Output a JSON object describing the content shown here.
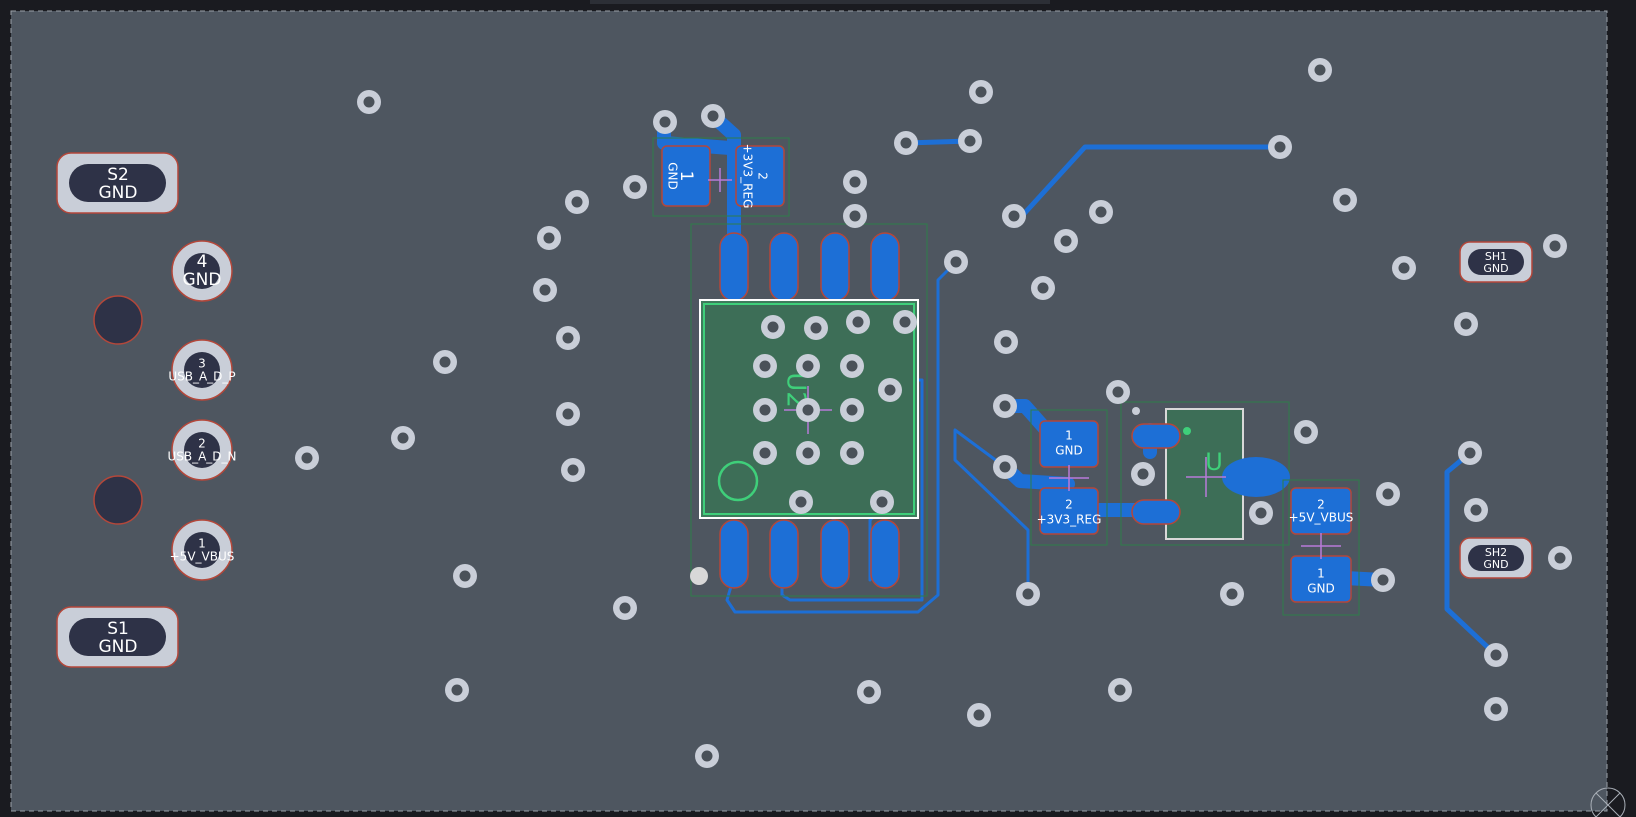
{
  "editor": {
    "view": "PCB board layout",
    "colors": {
      "background": "#1a1b20",
      "board": "#4e5660",
      "copper": "#1d6fd6",
      "via_ring": "#c9ced8",
      "silk": "#3fcf7a",
      "pad_outline": "#b4473a"
    }
  },
  "connector_j1": {
    "shield_top": {
      "num": "S2",
      "net": "GND"
    },
    "shield_bottom": {
      "num": "S1",
      "net": "GND"
    },
    "pin4": {
      "num": "4",
      "net": "GND"
    },
    "pin3": {
      "num": "3",
      "net": "USB_A_D_P"
    },
    "pin2": {
      "num": "2",
      "net": "USB_A_D_N"
    },
    "pin1": {
      "num": "1",
      "net": "+5V_VBUS"
    }
  },
  "cap_top": {
    "pin1": {
      "num": "1",
      "net": "GND"
    },
    "pin2": {
      "num": "2",
      "net": "+3V3_REG"
    }
  },
  "ic_u2": {
    "designator": "U2"
  },
  "cap_mid": {
    "pin1": {
      "num": "1",
      "net": "GND"
    },
    "pin2": {
      "num": "2",
      "net": "+3V3_REG"
    }
  },
  "regulator": {
    "designator": "U"
  },
  "cap_right": {
    "pin2": {
      "num": "2",
      "net": "+5V_VBUS"
    },
    "pin1": {
      "num": "1",
      "net": "GND"
    }
  },
  "shield_pads": {
    "sh1": {
      "num": "SH1",
      "net": "GND"
    },
    "sh2": {
      "num": "SH2",
      "net": "GND"
    }
  }
}
